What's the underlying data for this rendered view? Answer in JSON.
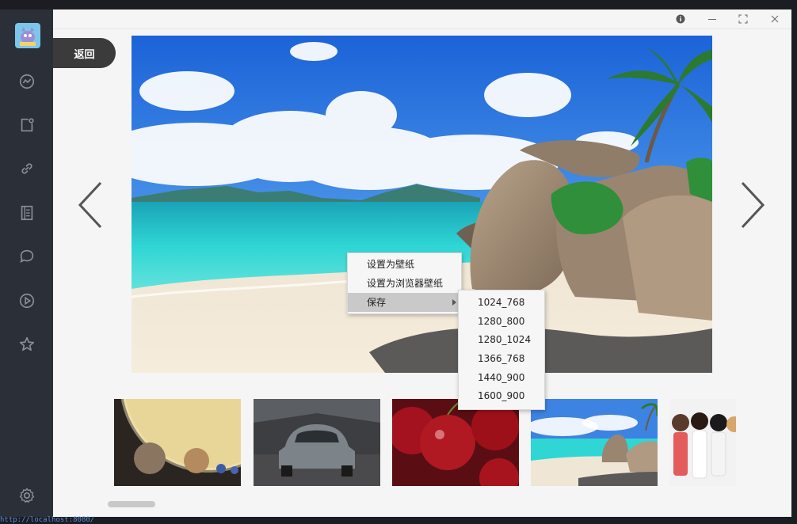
{
  "window": {
    "controls": {
      "info_icon": "info-icon",
      "minimize_icon": "minimize-icon",
      "maximize_icon": "maximize-icon",
      "close_icon": "close-icon"
    }
  },
  "toolbar": {
    "back_label": "返回"
  },
  "sidebar": {
    "items": [
      {
        "icon": "trend-icon"
      },
      {
        "icon": "notification-icon"
      },
      {
        "icon": "link-icon"
      },
      {
        "icon": "book-icon"
      },
      {
        "icon": "chat-icon"
      },
      {
        "icon": "play-icon"
      },
      {
        "icon": "star-icon"
      }
    ],
    "settings_icon": "gear-icon"
  },
  "viewer": {
    "prev_icon": "chevron-left-icon",
    "next_icon": "chevron-right-icon",
    "thumbnails": [
      {
        "subject": "planets"
      },
      {
        "subject": "sports-car"
      },
      {
        "subject": "cherries"
      },
      {
        "subject": "beach"
      },
      {
        "subject": "anime-girls"
      }
    ]
  },
  "context_menu": {
    "items": [
      {
        "label": "设置为壁纸"
      },
      {
        "label": "设置为浏览器壁纸"
      },
      {
        "label": "保存"
      }
    ],
    "submenu": [
      "1024_768",
      "1280_800",
      "1280_1024",
      "1366_768",
      "1440_900",
      "1600_900"
    ]
  },
  "status_bar": {
    "url": "http://localhost:8080/"
  },
  "colors": {
    "sidebar_bg": "#2b2f37",
    "content_bg": "#f5f5f5",
    "back_button": "#3b3b3b",
    "menu_highlight": "#c9c9c9"
  }
}
